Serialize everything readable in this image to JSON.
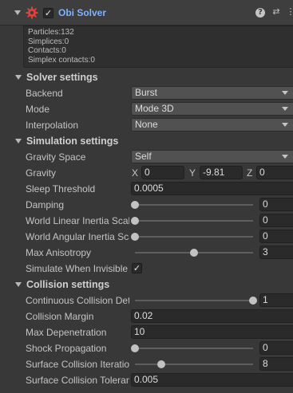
{
  "component": {
    "title": "Obi Solver",
    "enabled": "✓",
    "icon": "gear-red-icon",
    "buttons": [
      "help-icon",
      "presets-icon",
      "menu-icon"
    ],
    "help_glyph": "?",
    "presets_glyph": "⇄",
    "menu_glyph": "⋮"
  },
  "stats": {
    "particles": "Particles:132",
    "simplices": "Simplices:0",
    "contacts": "Contacts:0",
    "simplex_contacts": "Simplex contacts:0"
  },
  "solver_settings": {
    "title": "Solver settings",
    "backend_label": "Backend",
    "backend_value": "Burst",
    "mode_label": "Mode",
    "mode_value": "Mode 3D",
    "interpolation_label": "Interpolation",
    "interpolation_value": "None"
  },
  "simulation_settings": {
    "title": "Simulation settings",
    "gravity_space_label": "Gravity Space",
    "gravity_space_value": "Self",
    "gravity_label": "Gravity",
    "gravity_x_label": "X",
    "gravity_x": "0",
    "gravity_y_label": "Y",
    "gravity_y": "-9.81",
    "gravity_z_label": "Z",
    "gravity_z": "0",
    "sleep_threshold_label": "Sleep Threshold",
    "sleep_threshold": "0.0005",
    "damping_label": "Damping",
    "damping": "0",
    "damping_fraction": 0.0,
    "linear_inertia_label": "World Linear Inertia Scale",
    "linear_inertia": "0",
    "linear_inertia_fraction": 0.0,
    "angular_inertia_label": "World Angular Inertia Scale",
    "angular_inertia": "0",
    "angular_inertia_fraction": 0.0,
    "max_anisotropy_label": "Max Anisotropy",
    "max_anisotropy": "3",
    "max_anisotropy_fraction": 0.5,
    "simulate_invisible_label": "Simulate When Invisible",
    "simulate_invisible": "✓"
  },
  "collision_settings": {
    "title": "Collision settings",
    "ccd_label": "Continuous Collision Detection",
    "ccd": "1",
    "ccd_fraction": 1.0,
    "collision_margin_label": "Collision Margin",
    "collision_margin": "0.02",
    "max_depenetration_label": "Max Depenetration",
    "max_depenetration": "10",
    "shock_propagation_label": "Shock Propagation",
    "shock_propagation": "0",
    "shock_propagation_fraction": 0.0,
    "surface_iterations_label": "Surface Collision Iterations",
    "surface_iterations": "8",
    "surface_iterations_fraction": 0.222,
    "surface_tolerance_label": "Surface Collision Tolerance",
    "surface_tolerance": "0.005"
  },
  "colors": {
    "background": "#383838",
    "title_accent": "#7fb2ff",
    "gear_icon": "#e0443a"
  }
}
